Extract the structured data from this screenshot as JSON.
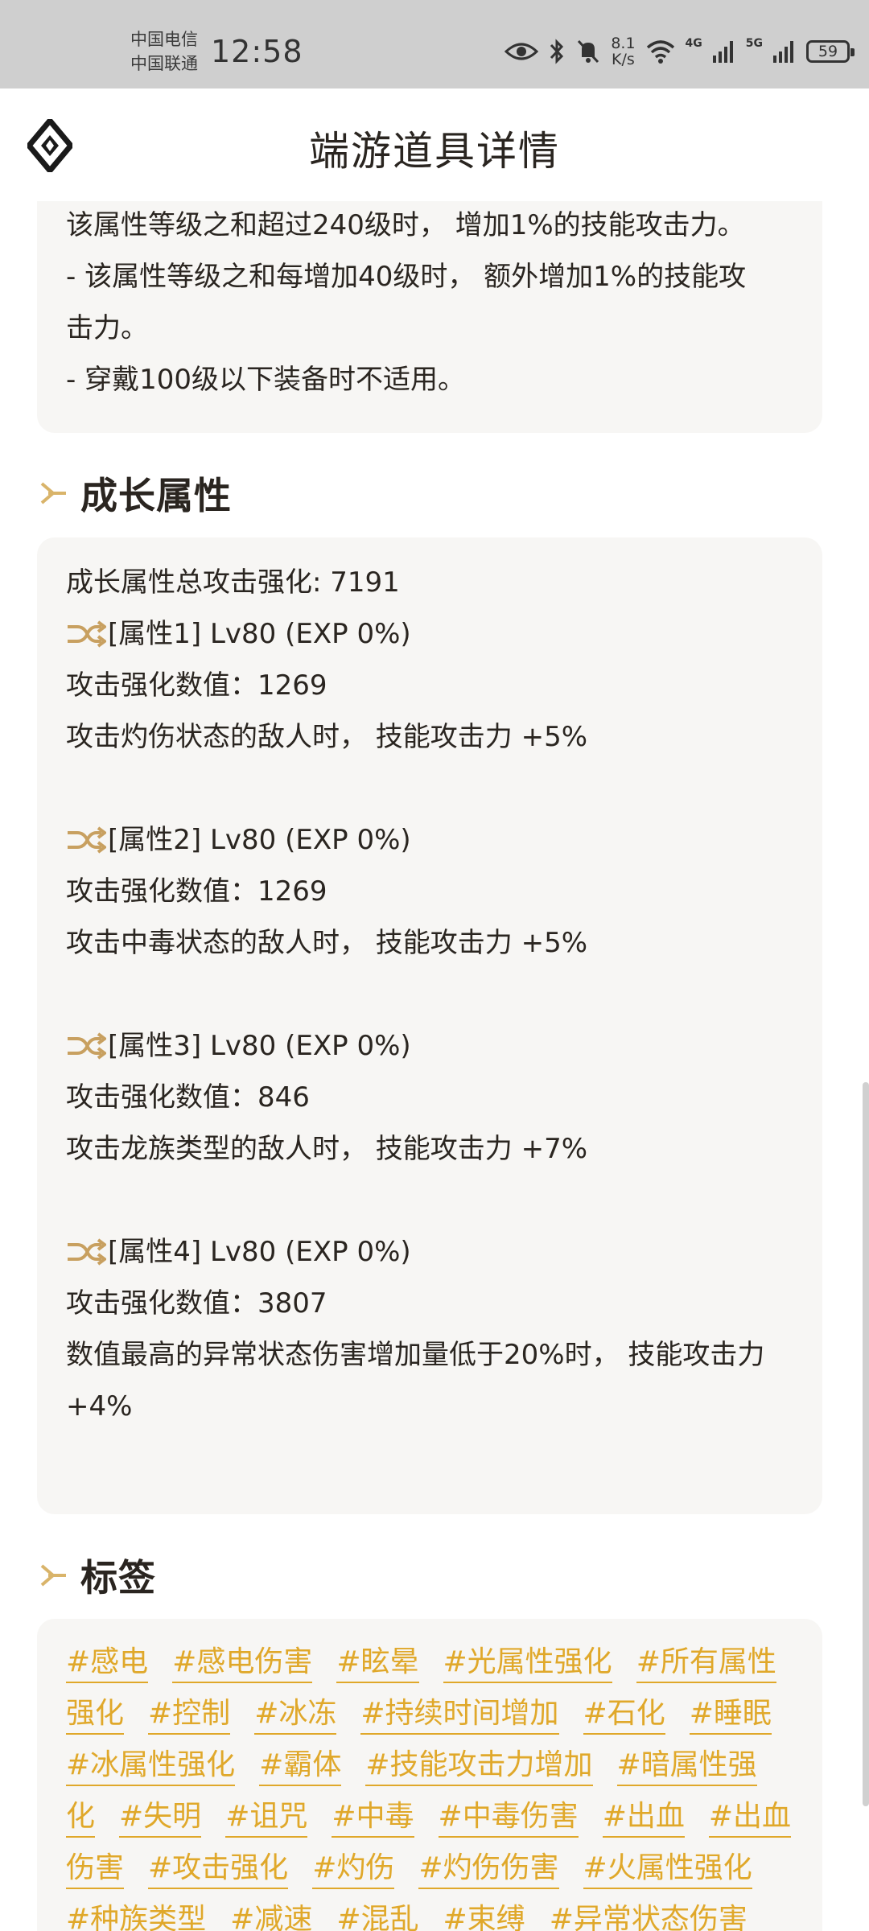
{
  "status_bar": {
    "carrier1": "中国电信",
    "carrier2": "中国联通",
    "time": "12:58",
    "speed_value": "8.1",
    "speed_unit": "K/s",
    "net1": "4G",
    "net2": "5G",
    "battery": "59"
  },
  "header": {
    "title": "端游道具详情"
  },
  "set_card": {
    "lines": [
      "该属性等级之和超过240级时， 增加1%的技能攻击力。",
      "- 该属性等级之和每增加40级时， 额外增加1%的技能攻",
      "击力。",
      "- 穿戴100级以下装备时不适用。"
    ]
  },
  "growth_section": {
    "title": "成长属性",
    "total": "成长属性总攻击强化: 7191",
    "attrs": [
      {
        "head": "[属性1] Lv80 (EXP 0%)",
        "value": "攻击强化数值：1269",
        "effect": "攻击灼伤状态的敌人时， 技能攻击力 +5%"
      },
      {
        "head": "[属性2] Lv80 (EXP 0%)",
        "value": "攻击强化数值：1269",
        "effect": "攻击中毒状态的敌人时， 技能攻击力 +5%"
      },
      {
        "head": "[属性3] Lv80 (EXP 0%)",
        "value": "攻击强化数值：846",
        "effect": "攻击龙族类型的敌人时， 技能攻击力 +7%"
      },
      {
        "head": "[属性4] Lv80 (EXP 0%)",
        "value": "攻击强化数值：3807",
        "effect": "数值最高的异常状态伤害增加量低于20%时， 技能攻击力 +4%"
      }
    ]
  },
  "tags_section": {
    "title": "标签",
    "tags": [
      "#感电",
      "#感电伤害",
      "#眩晕",
      "#光属性强化",
      "#所有属性强化",
      "#控制",
      "#冰冻",
      "#持续时间增加",
      "#石化",
      "#睡眠",
      "#冰属性强化",
      "#霸体",
      "#技能攻击力增加",
      "#暗属性强化",
      "#失明",
      "#诅咒",
      "#中毒",
      "#中毒伤害",
      "#出血",
      "#出血伤害",
      "#攻击强化",
      "#灼伤",
      "#灼伤伤害",
      "#火属性强化",
      "#种族类型",
      "#减速",
      "#混乱",
      "#束缚",
      "#异常状态伤害"
    ]
  },
  "colors": {
    "accent": "#e0a82a",
    "card_bg": "#f7f6f4",
    "text": "#2a2520",
    "status_bg": "#cfcfcf"
  }
}
